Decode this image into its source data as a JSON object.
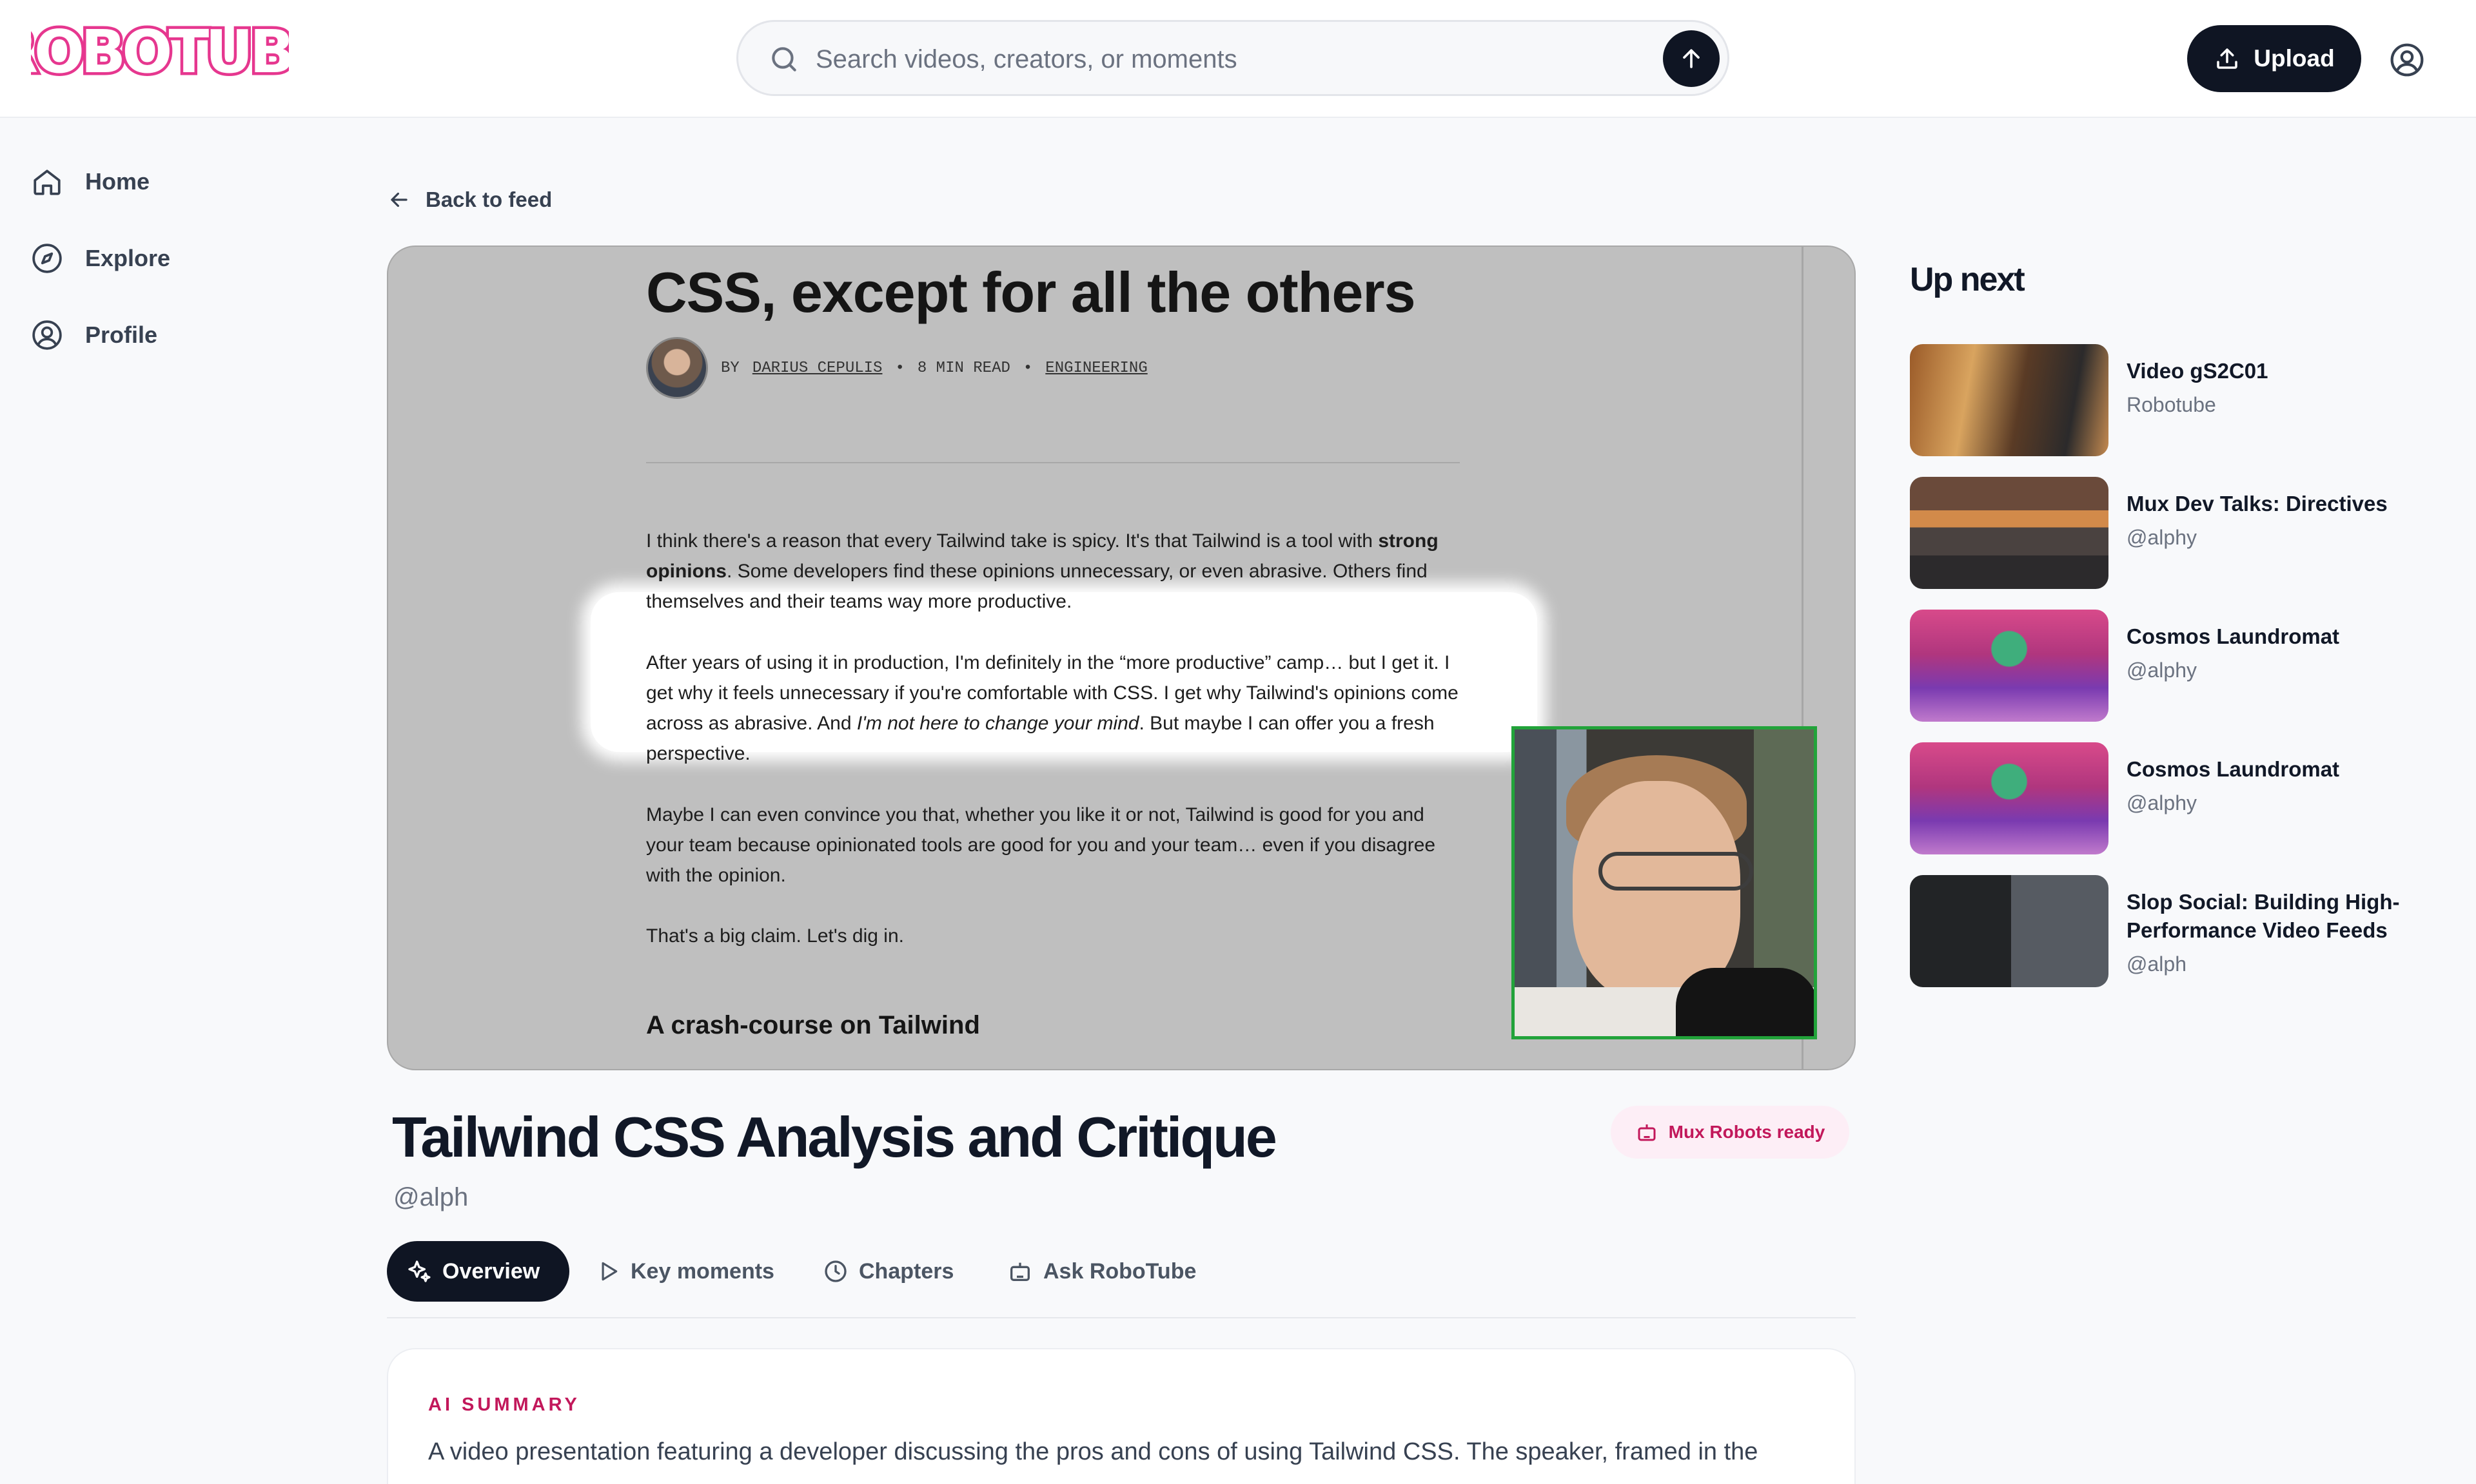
{
  "header": {
    "logo_alt": "ROBOTUBE",
    "search_placeholder": "Search videos, creators, or moments",
    "upload_label": "Upload"
  },
  "sidebar": {
    "items": [
      {
        "label": "Home",
        "icon": "home-icon"
      },
      {
        "label": "Explore",
        "icon": "compass-icon"
      },
      {
        "label": "Profile",
        "icon": "user-circle-icon"
      }
    ]
  },
  "back_label": "Back to feed",
  "player": {
    "article_title": "CSS, except for all the others",
    "byline_prefix": "BY",
    "author": "DARIUS CEPULIS",
    "read_time": "8 MIN READ",
    "category": "ENGINEERING",
    "para1_a": "I think there's a reason that every Tailwind take is spicy. It's that Tailwind is a tool with ",
    "para1_bold": "strong opinions",
    "para1_b": ". Some developers find these opinions unnecessary, or even abrasive. Others find themselves and their teams way more productive.",
    "para2_a": "After years of using it in production, I'm definitely in the “more productive” camp… but I get it. I get why it feels unnecessary if you're comfortable with CSS. I get why Tailwind's opinions come across as abrasive. And ",
    "para2_italic": "I'm not here to change your mind",
    "para2_b": ". But maybe I can offer you a fresh perspective.",
    "para3": "Maybe I can even convince you that, whether you like it or not, Tailwind is good for you and your team because opinionated tools are good for you and your team… even if you disagree with the opinion.",
    "para4": "That's a big claim. Let's dig in.",
    "heading2": "A crash-course on Tailwind"
  },
  "video": {
    "title": "Tailwind CSS Analysis and Critique",
    "channel": "@alph",
    "badge": "Mux Robots ready"
  },
  "tabs": [
    {
      "label": "Overview",
      "icon": "sparkles-icon",
      "active": true
    },
    {
      "label": "Key moments",
      "icon": "play-icon",
      "active": false
    },
    {
      "label": "Chapters",
      "icon": "clock-icon",
      "active": false
    },
    {
      "label": "Ask RoboTube",
      "icon": "robot-icon",
      "active": false
    }
  ],
  "summary": {
    "label": "AI SUMMARY",
    "text": "A video presentation featuring a developer discussing the pros and cons of using Tailwind CSS. The speaker, framed in the"
  },
  "up_next": {
    "title": "Up next",
    "items": [
      {
        "title": "Video gS2C01",
        "channel": "Robotube"
      },
      {
        "title": "Mux Dev Talks: Directives",
        "channel": "@alphy"
      },
      {
        "title": "Cosmos Laundromat",
        "channel": "@alphy"
      },
      {
        "title": "Cosmos Laundromat",
        "channel": "@alphy"
      },
      {
        "title": "Slop Social: Building High-Performance Video Feeds",
        "channel": "@alph"
      }
    ]
  },
  "colors": {
    "brand_pink": "#e6378f",
    "dark": "#0f1523",
    "accent": "#c2185b",
    "pip_border": "#22a33a"
  }
}
